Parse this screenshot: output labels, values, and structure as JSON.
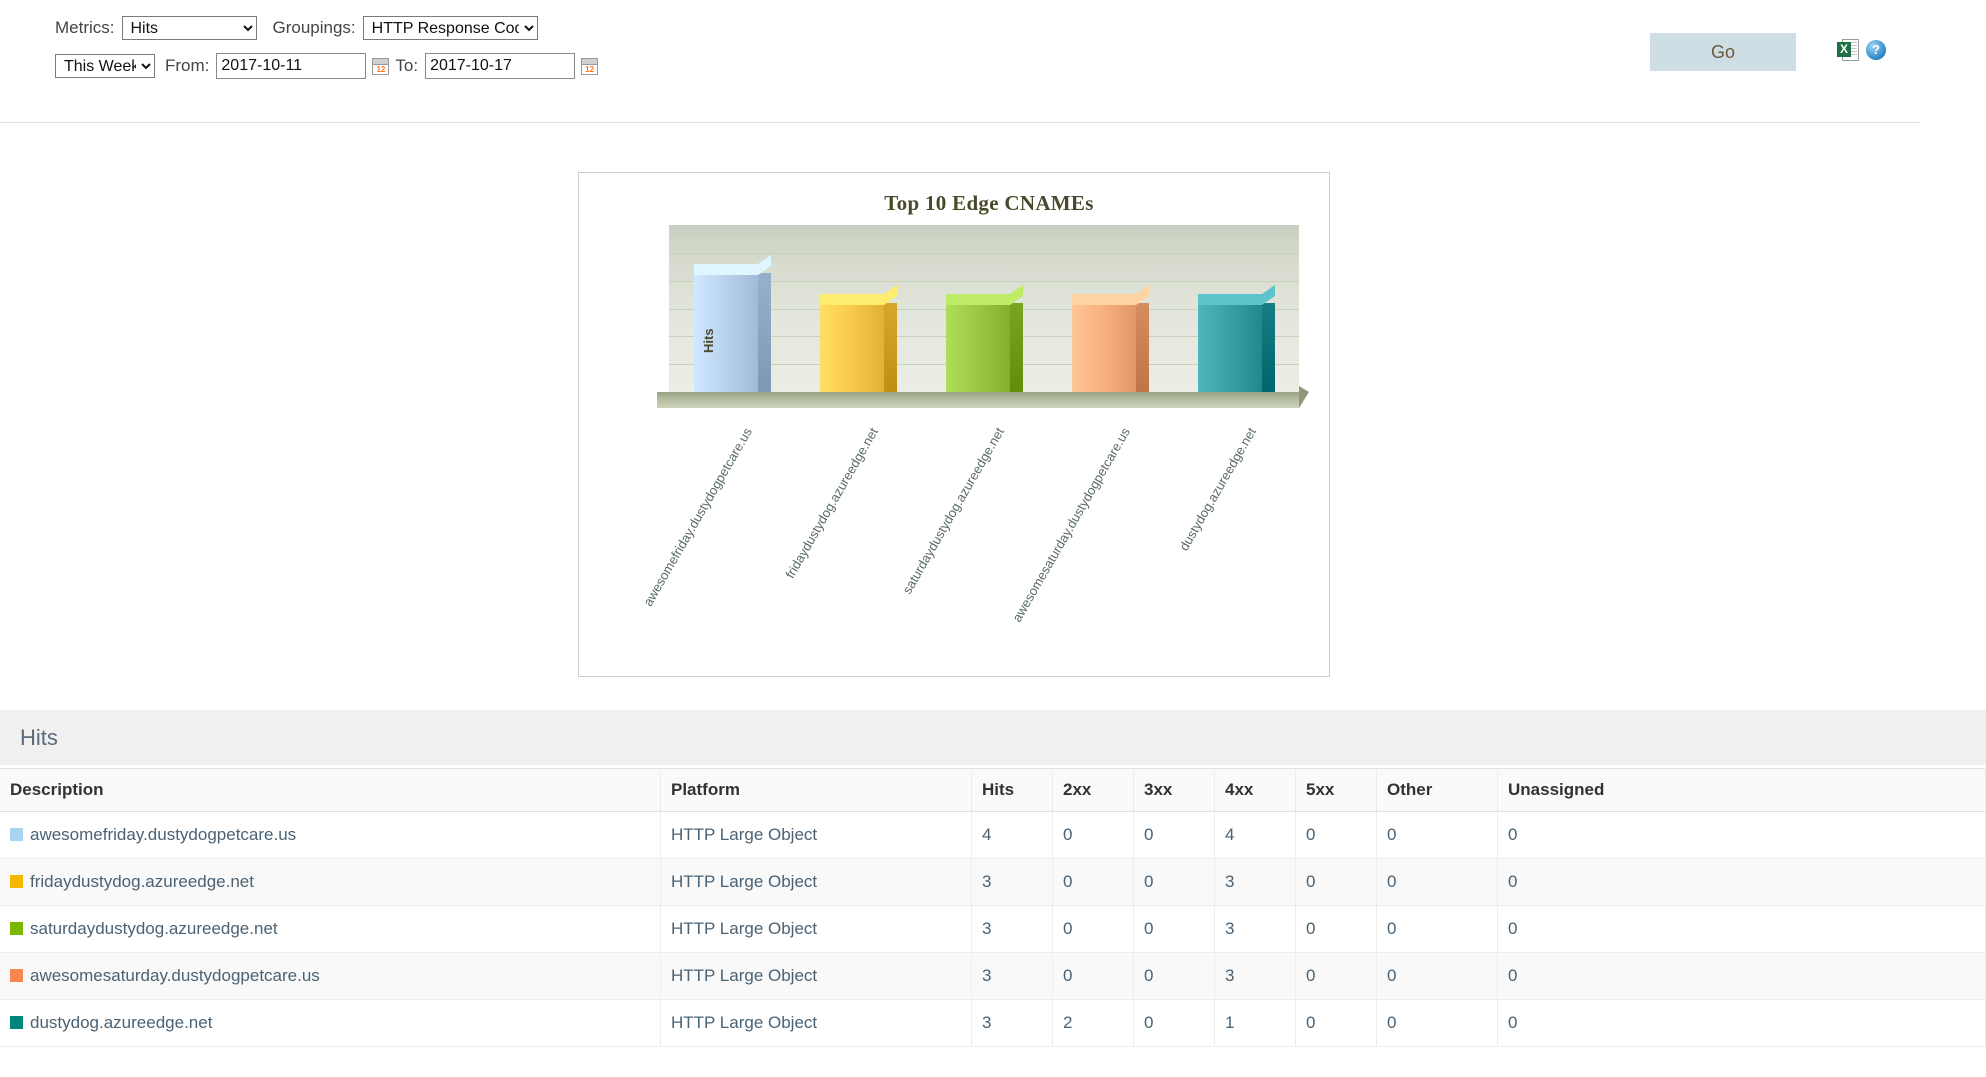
{
  "toolbar": {
    "metrics_label": "Metrics:",
    "metrics_value": "Hits",
    "groupings_label": "Groupings:",
    "groupings_value": "HTTP Response Codes",
    "range_value": "This Week",
    "from_label": "From:",
    "from_value": "2017-10-11",
    "to_label": "To:",
    "to_value": "2017-10-17",
    "go_label": "Go",
    "excel_icon": "excel-export-icon",
    "excel_glyph": "X",
    "help_icon": "help-icon",
    "help_glyph": "?",
    "calendar_icon": "calendar-icon"
  },
  "chart_data": {
    "type": "bar",
    "title": "Top 10 Edge CNAMEs",
    "xlabel": "",
    "ylabel": "Hits",
    "ylim": [
      0,
      5
    ],
    "grid": true,
    "legend": "none",
    "categories": [
      "awesomefriday.dustydogpetcare.us",
      "fridaydustydog.azureedge.net",
      "saturdaydustydog.azureedge.net",
      "awesomesaturday.dustydogpetcare.us",
      "dustydog.azureedge.net"
    ],
    "values": [
      4,
      3,
      3,
      3,
      3
    ],
    "colors": [
      "#a9c2dd",
      "#e8b93c",
      "#8ab833",
      "#e8a070",
      "#2a8f97"
    ]
  },
  "table_section": {
    "heading": "Hits",
    "columns": [
      "Description",
      "Platform",
      "Hits",
      "2xx",
      "3xx",
      "4xx",
      "5xx",
      "Other",
      "Unassigned"
    ],
    "rows": [
      {
        "color": "#a8d4f0",
        "description": "awesomefriday.dustydogpetcare.us",
        "platform": "HTTP Large Object",
        "hits": "4",
        "c2xx": "0",
        "c3xx": "0",
        "c4xx": "4",
        "c5xx": "0",
        "other": "0",
        "unassigned": "0"
      },
      {
        "color": "#f5b800",
        "description": "fridaydustydog.azureedge.net",
        "platform": "HTTP Large Object",
        "hits": "3",
        "c2xx": "0",
        "c3xx": "0",
        "c4xx": "3",
        "c5xx": "0",
        "other": "0",
        "unassigned": "0"
      },
      {
        "color": "#7ab800",
        "description": "saturdaydustydog.azureedge.net",
        "platform": "HTTP Large Object",
        "hits": "3",
        "c2xx": "0",
        "c3xx": "0",
        "c4xx": "3",
        "c5xx": "0",
        "other": "0",
        "unassigned": "0"
      },
      {
        "color": "#f7874e",
        "description": "awesomesaturday.dustydogpetcare.us",
        "platform": "HTTP Large Object",
        "hits": "3",
        "c2xx": "0",
        "c3xx": "0",
        "c4xx": "3",
        "c5xx": "0",
        "other": "0",
        "unassigned": "0"
      },
      {
        "color": "#00857d",
        "description": "dustydog.azureedge.net",
        "platform": "HTTP Large Object",
        "hits": "3",
        "c2xx": "2",
        "c3xx": "0",
        "c4xx": "1",
        "c5xx": "0",
        "other": "0",
        "unassigned": "0"
      }
    ]
  }
}
